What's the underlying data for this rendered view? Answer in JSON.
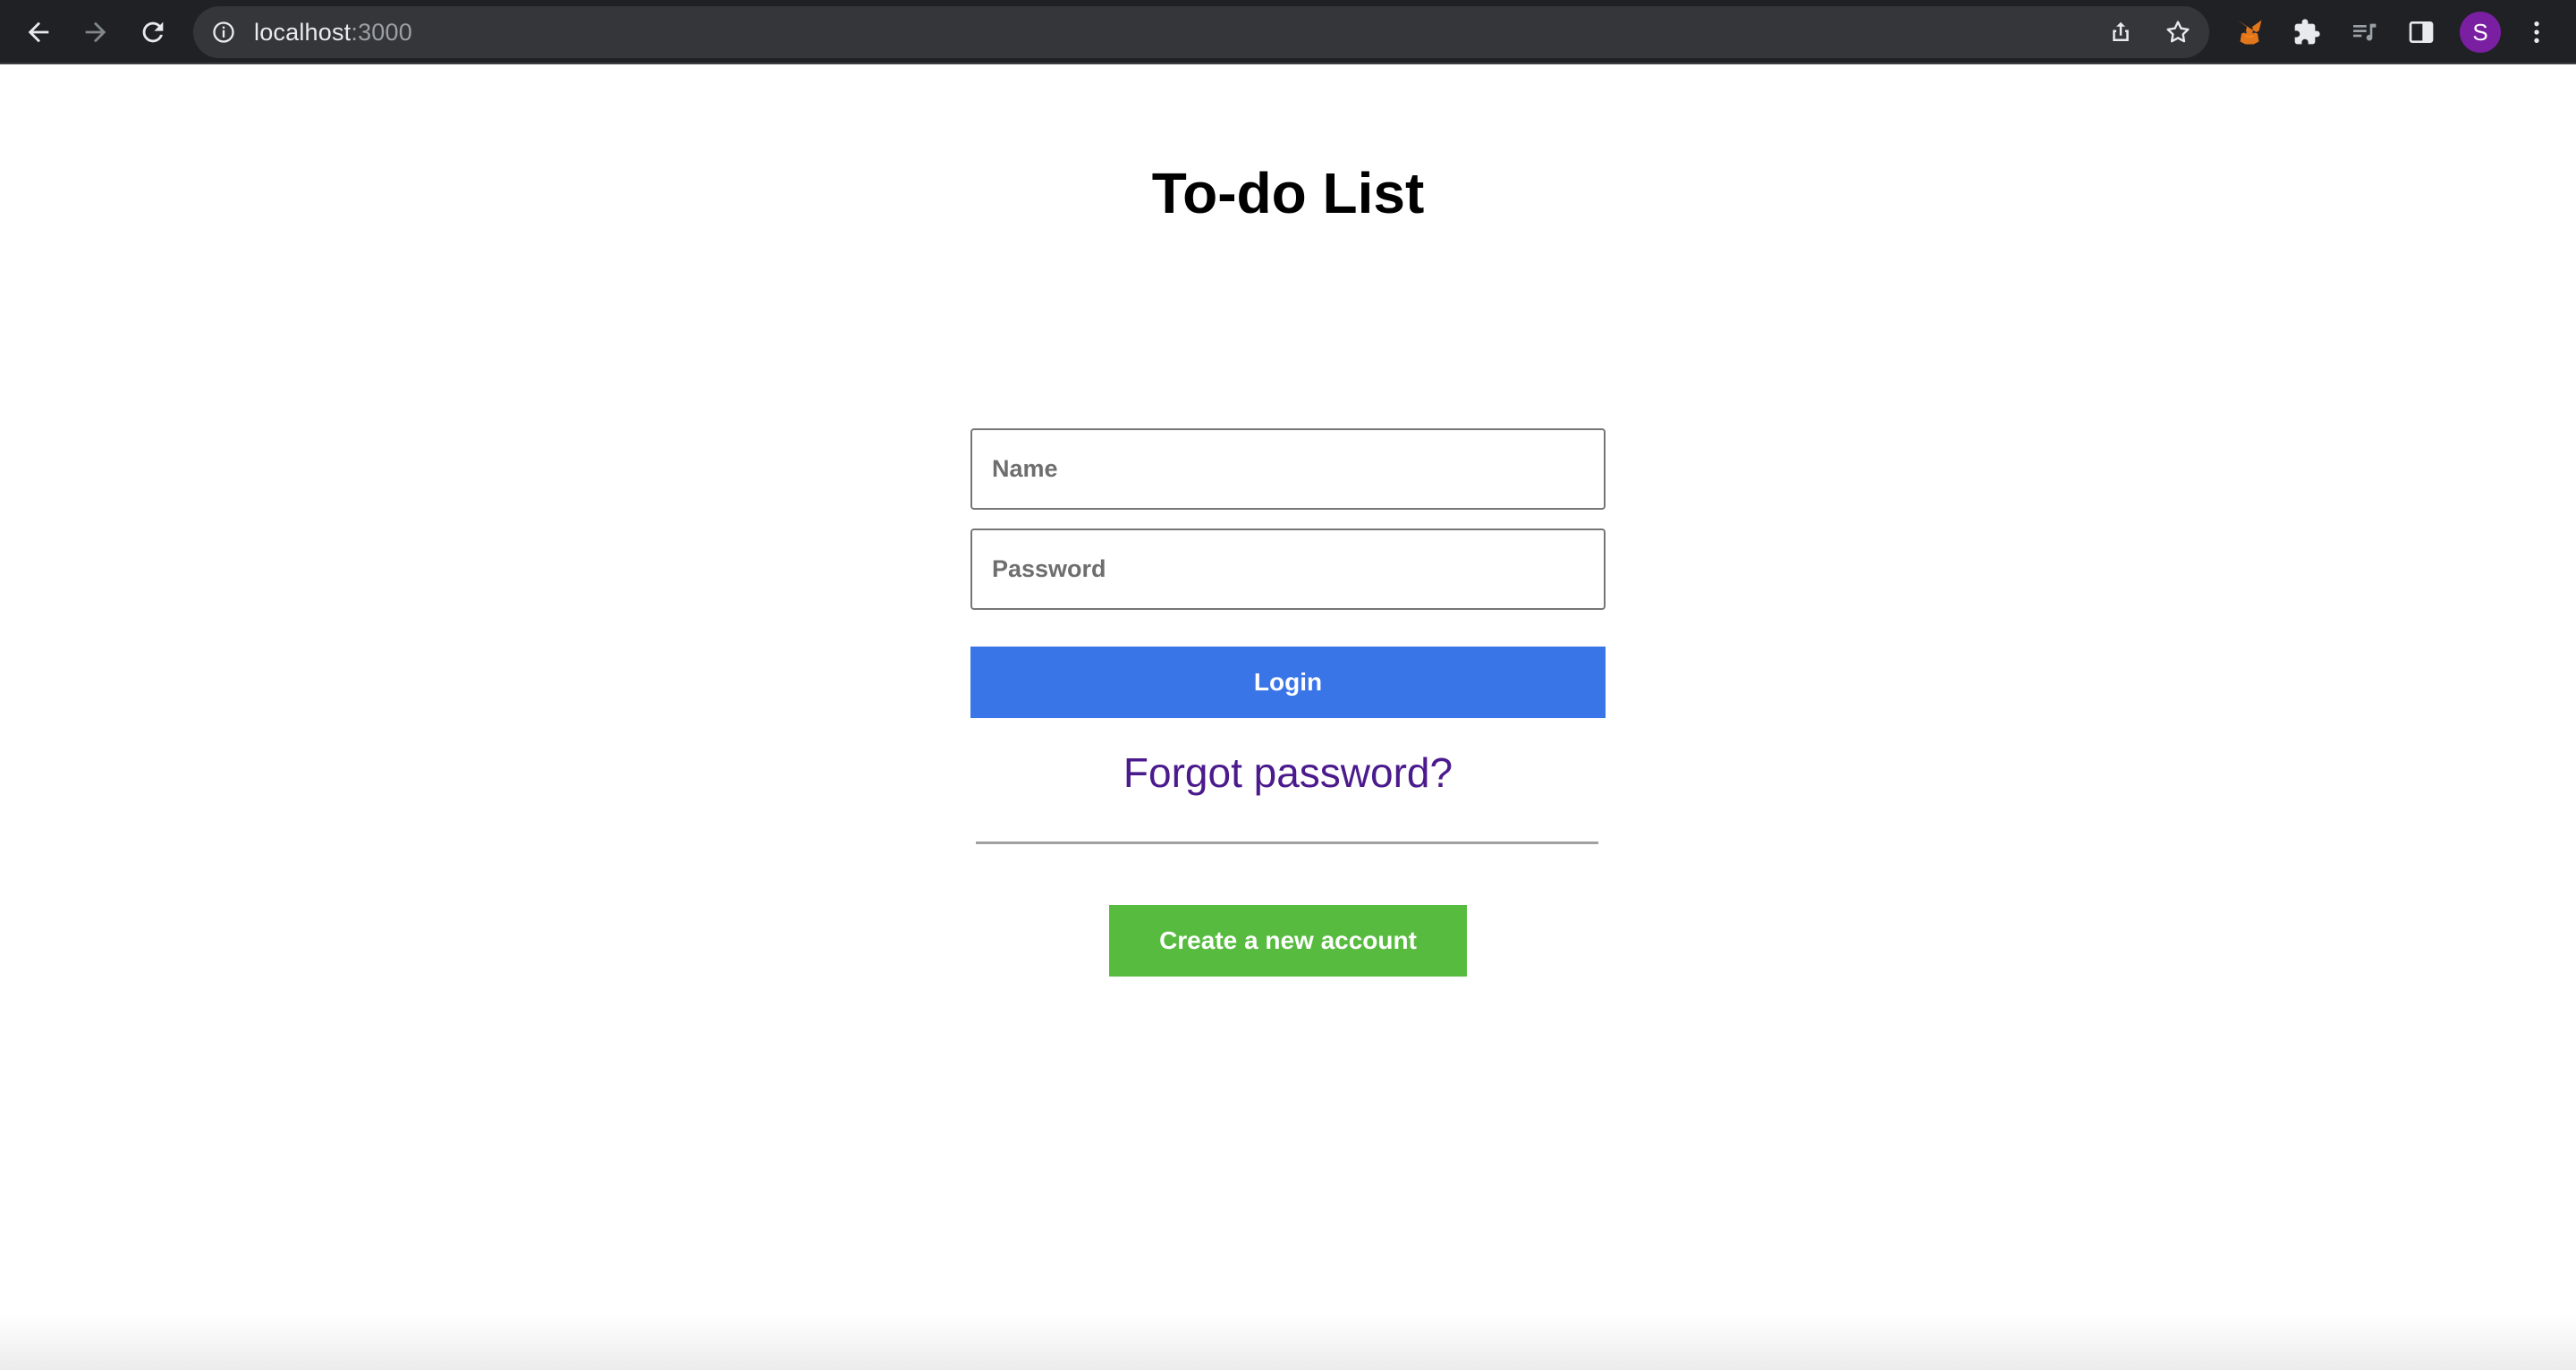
{
  "browser": {
    "url_host": "localhost",
    "url_port": ":3000",
    "profile_initial": "S",
    "icons": {
      "back": "arrow-left-icon",
      "forward": "arrow-right-icon",
      "reload": "reload-icon",
      "site_info": "info-icon",
      "share": "share-icon",
      "bookmark": "star-icon",
      "extension_fox": "metamask-fox-icon",
      "extensions": "puzzle-icon",
      "media": "media-queue-icon",
      "side_panel": "side-panel-icon",
      "menu": "kebab-menu-icon"
    },
    "colors": {
      "chrome_bg": "#202124",
      "omnibox_bg": "#35363a",
      "avatar_bg": "#7b1fa2"
    }
  },
  "page": {
    "title": "To-do List",
    "form": {
      "name_placeholder": "Name",
      "password_placeholder": "Password",
      "login_label": "Login",
      "forgot_label": "Forgot password?",
      "create_label": "Create a new account"
    },
    "colors": {
      "login_button": "#3a75e8",
      "create_button": "#56bb3f",
      "forgot_link": "#4b1a8c"
    }
  }
}
